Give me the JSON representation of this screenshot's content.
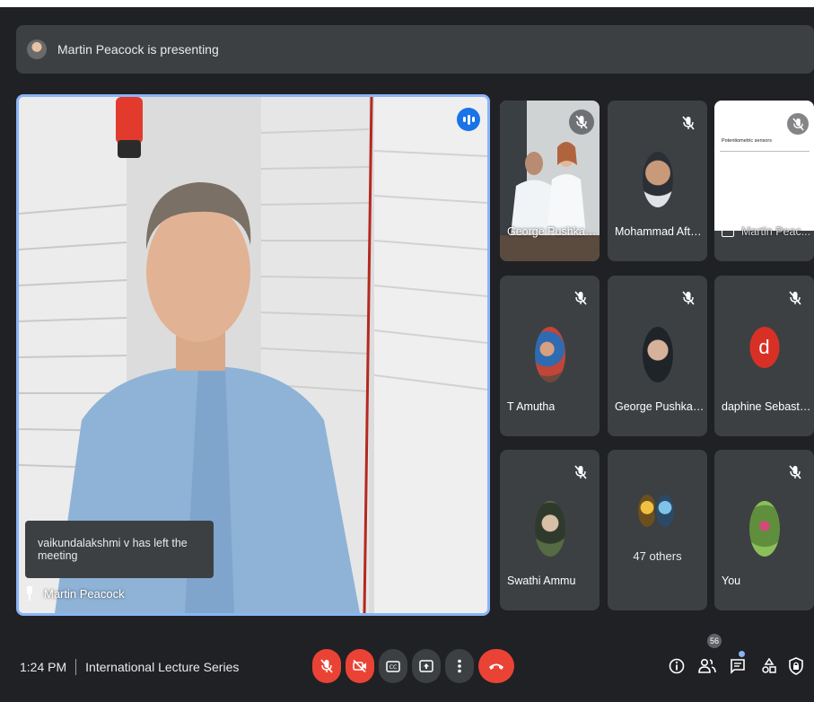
{
  "banner": {
    "text": "Martin Peacock is presenting"
  },
  "main": {
    "speaker_name": "Martin Peacock",
    "toast": "vaikundalakshmi v has left the meeting"
  },
  "tiles": [
    {
      "name": "George Pushkarev"
    },
    {
      "name": "Mohammad Aftab..."
    },
    {
      "name": "Martin Peac...",
      "slide_title": "Potentiometric sensors"
    },
    {
      "name": "T Amutha"
    },
    {
      "name": "George Pushkarev"
    },
    {
      "name": "daphine Sebastian",
      "initial": "d"
    },
    {
      "name": "Swathi Ammu"
    },
    {
      "name": "47 others"
    },
    {
      "name": "You"
    }
  ],
  "bottom": {
    "time": "1:24 PM",
    "meeting_title": "International Lecture Series",
    "participants_count": "56"
  },
  "colors": {
    "background": "#202124",
    "surface": "#3c4043",
    "accent": "#8ab4f8",
    "danger": "#ea4335"
  }
}
